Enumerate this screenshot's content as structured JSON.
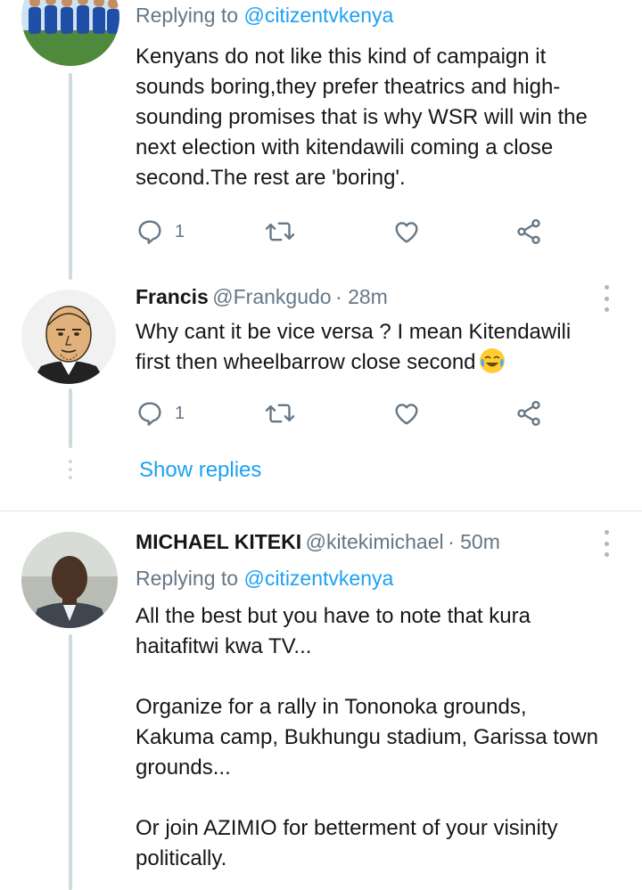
{
  "tweets": [
    {
      "replying_label": "Replying to",
      "replying_to": "@citizentvkenya",
      "text": "Kenyans do not like this kind of campaign it\nsounds boring,they prefer theatrics and high-\nsounding promises that is why WSR will win the\nnext election with kitendawili coming a close\nsecond.The rest are 'boring'.",
      "reply_count": "1"
    },
    {
      "name": "Francis",
      "handle": "@Frankgudo",
      "time": "· 28m",
      "text": "Why cant it be vice versa ? I mean Kitendawili\nfirst then wheelbarrow close second",
      "emoji": "face-with-tears-of-joy",
      "reply_count": "1"
    },
    {
      "name": "MICHAEL KITEKI",
      "handle": "@kitekimichael",
      "time": "· 50m",
      "replying_label": "Replying to",
      "replying_to": "@citizentvkenya",
      "text": "All the best but you have to note that kura\nhaitafitwi kwa TV...\n\nOrganize for a rally in Tononoka grounds,\nKakuma camp, Bukhungu stadium, Garissa town\ngrounds...\n\nOr join AZIMIO for betterment of your visinity\npolitically."
    }
  ],
  "show_replies_label": "Show replies",
  "colors": {
    "accent": "#1da1f2",
    "secondary_text": "#657786",
    "thread_line": "#cfd9de"
  },
  "icons": [
    "reply-icon",
    "retweet-icon",
    "like-icon",
    "share-icon",
    "more-icon"
  ]
}
